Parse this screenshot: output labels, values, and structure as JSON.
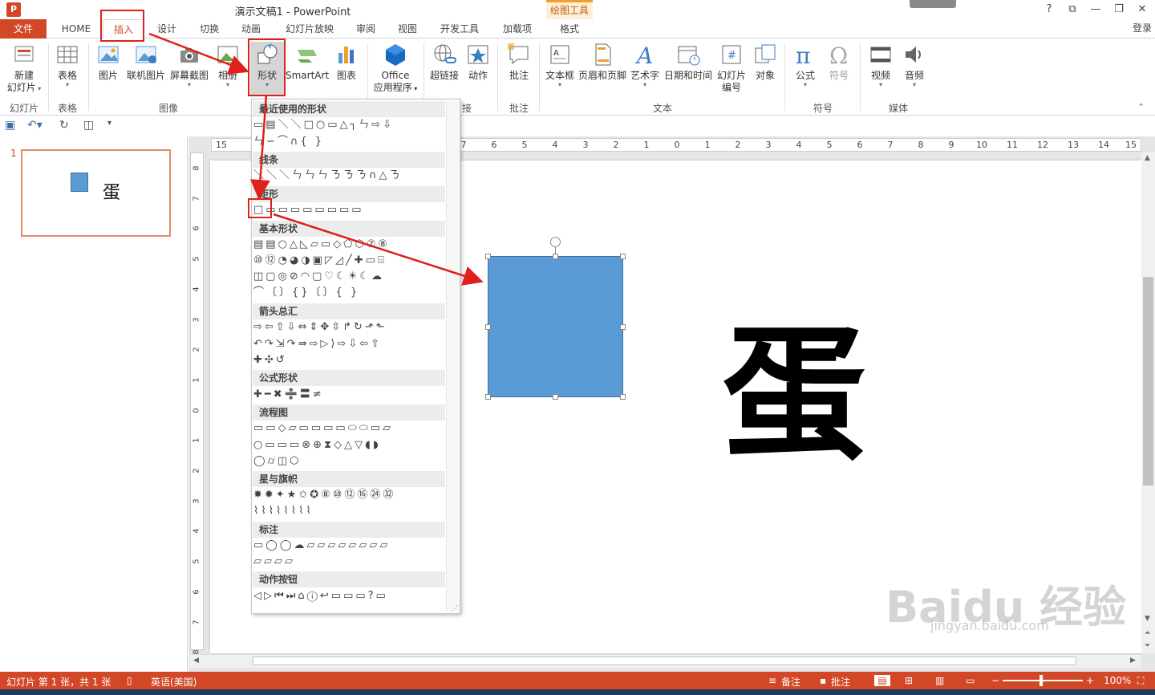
{
  "window": {
    "title": "演示文稿1 - PowerPoint",
    "contextual_group": "绘图工具",
    "controls": [
      "?",
      "⧉",
      "—",
      "❐",
      "✕"
    ],
    "login": "登录"
  },
  "tabs": {
    "file": "文件",
    "items": [
      "HOME",
      "插入",
      "设计",
      "切换",
      "动画",
      "幻灯片放映",
      "审阅",
      "视图",
      "开发工具",
      "加载项"
    ],
    "format": "格式"
  },
  "ribbon": {
    "buttons": {
      "new_slide": [
        "新建",
        "幻灯片"
      ],
      "table": "表格",
      "picture": "图片",
      "online_picture": "联机图片",
      "screenshot": "屏幕截图",
      "album": "相册",
      "shapes": "形状",
      "smartart": "SmartArt",
      "chart": "图表",
      "office_apps": [
        "Office",
        "应用程序"
      ],
      "hyperlink": "超链接",
      "action": "动作",
      "comment": "批注",
      "textbox": "文本框",
      "header_footer": "页眉和页脚",
      "wordart": "艺术字",
      "datetime": "日期和时间",
      "slide_number": [
        "幻灯片",
        "编号"
      ],
      "object": "对象",
      "equation": "公式",
      "symbol": "符号",
      "video": "视频",
      "audio": "音频"
    },
    "groups": {
      "slides": "幻灯片",
      "tables": "表格",
      "images": "图像",
      "links": "接",
      "comments": "批注",
      "text": "文本",
      "symbols": "符号",
      "media": "媒体"
    }
  },
  "slides_panel": {
    "number": "1",
    "thumb_char": "蛋"
  },
  "slide": {
    "big_char": "蛋"
  },
  "ruler": {
    "h": [
      "15",
      "7",
      "6",
      "5",
      "4",
      "3",
      "2",
      "1",
      "0",
      "1",
      "2",
      "3",
      "4",
      "5",
      "6",
      "7",
      "8",
      "9",
      "10",
      "11",
      "12",
      "13",
      "14",
      "15"
    ],
    "v": [
      "8",
      "7",
      "6",
      "5",
      "4",
      "3",
      "2",
      "1",
      "0",
      "1",
      "2",
      "3",
      "4",
      "5",
      "6",
      "7",
      "8"
    ]
  },
  "gallery": {
    "sections": [
      {
        "title": "最近使用的形状",
        "rows": [
          "▭▤＼＼□○▭△┐ㄣ⇨⇩",
          "ㄣ∽⌒∩{ }"
        ]
      },
      {
        "title": "线条",
        "rows": [
          "＼＼＼ㄣㄣㄣㄋㄋㄋ∩△ㄋ"
        ]
      },
      {
        "title": "矩形",
        "rows": [
          "□▭▭▭▭▭▭▭▭"
        ]
      },
      {
        "title": "基本形状",
        "rows": [
          "▤▤○△◺▱▭◇⬠⬡⑦⑧",
          "⑩⑫◔◕◑▣◸◿╱✚▭⌸",
          "◫▢◎⊘◠▢♡☾☀☾☁",
          "⌒〔〕{}〔〕{ }"
        ]
      },
      {
        "title": "箭头总汇",
        "rows": [
          "⇨⇦⇧⇩⇔⇕✥⇳↱↻⬏⬑",
          "↶↷⇲↷⇛⇨▷⟩⇨⇩⇦⇧",
          "✚✣↺"
        ]
      },
      {
        "title": "公式形状",
        "rows": [
          "✚━✖➗〓≠"
        ]
      },
      {
        "title": "流程图",
        "rows": [
          "▭▭◇▱▭▭▭▭⬭⬭▭▱",
          "○▭▭▭⊗⊕⧗◇△▽◖◗",
          "◯⌭◫⬡"
        ]
      },
      {
        "title": "星与旗帜",
        "rows": [
          "✸✹✦★✩✪⑧⑩⑫⑯㉔㉜",
          "⌇⌇⌇⌇⌇⌇⌇⌇"
        ]
      },
      {
        "title": "标注",
        "rows": [
          "▭◯◯☁▱▱▱▱▱▱▱▱",
          "▱▱▱▱"
        ]
      },
      {
        "title": "动作按钮",
        "rows": [
          "◁▷⏮⏭⌂ⓘ↩▭▭▭?▭"
        ]
      }
    ]
  },
  "watermark": {
    "brand": "Baidu 经验",
    "url": "jingyan.baidu.com"
  },
  "status": {
    "slide_info": "幻灯片 第 1 张，共 1 张",
    "language": "英语(美国)",
    "notes": "备注",
    "comments": "批注",
    "zoom": "100%"
  },
  "colors": {
    "accent": "#d24726",
    "shape_fill": "#5b9bd5",
    "annotation": "#e0201a"
  }
}
